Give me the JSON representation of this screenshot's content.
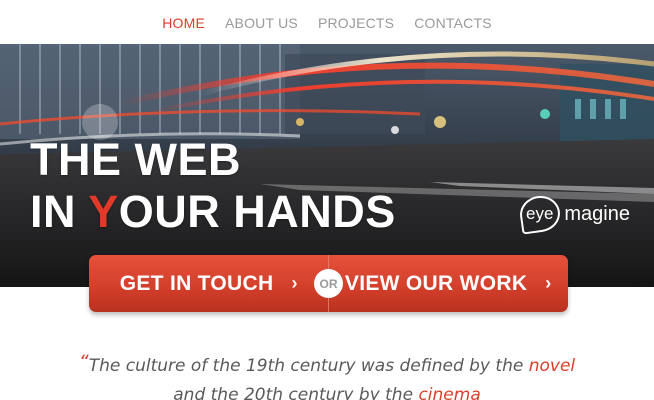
{
  "nav": {
    "items": [
      {
        "label": "HOME",
        "active": true
      },
      {
        "label": "ABOUT US",
        "active": false
      },
      {
        "label": "PROJECTS",
        "active": false
      },
      {
        "label": "CONTACTS",
        "active": false
      }
    ]
  },
  "hero": {
    "headline_line1": "THE WEB",
    "headline_line2_prefix": "IN ",
    "headline_line2_highlight": "Y",
    "headline_line2_suffix": "OUR HANDS",
    "logo_badge": "eye",
    "logo_word": "magine"
  },
  "cta": {
    "left_label": "GET IN TOUCH",
    "right_label": "VIEW OUR WORK",
    "or_label": "OR",
    "chevron": "›"
  },
  "quote": {
    "open_mark": "“",
    "line1_text": "The culture of the 19th century was defined by the ",
    "line1_highlight": "novel",
    "line2_text": "and the 20th century by the ",
    "line2_highlight": "cinema"
  },
  "colors": {
    "accent": "#d9402b",
    "cta_bg": "#d13e2a",
    "nav_text": "#9a9a9a"
  }
}
